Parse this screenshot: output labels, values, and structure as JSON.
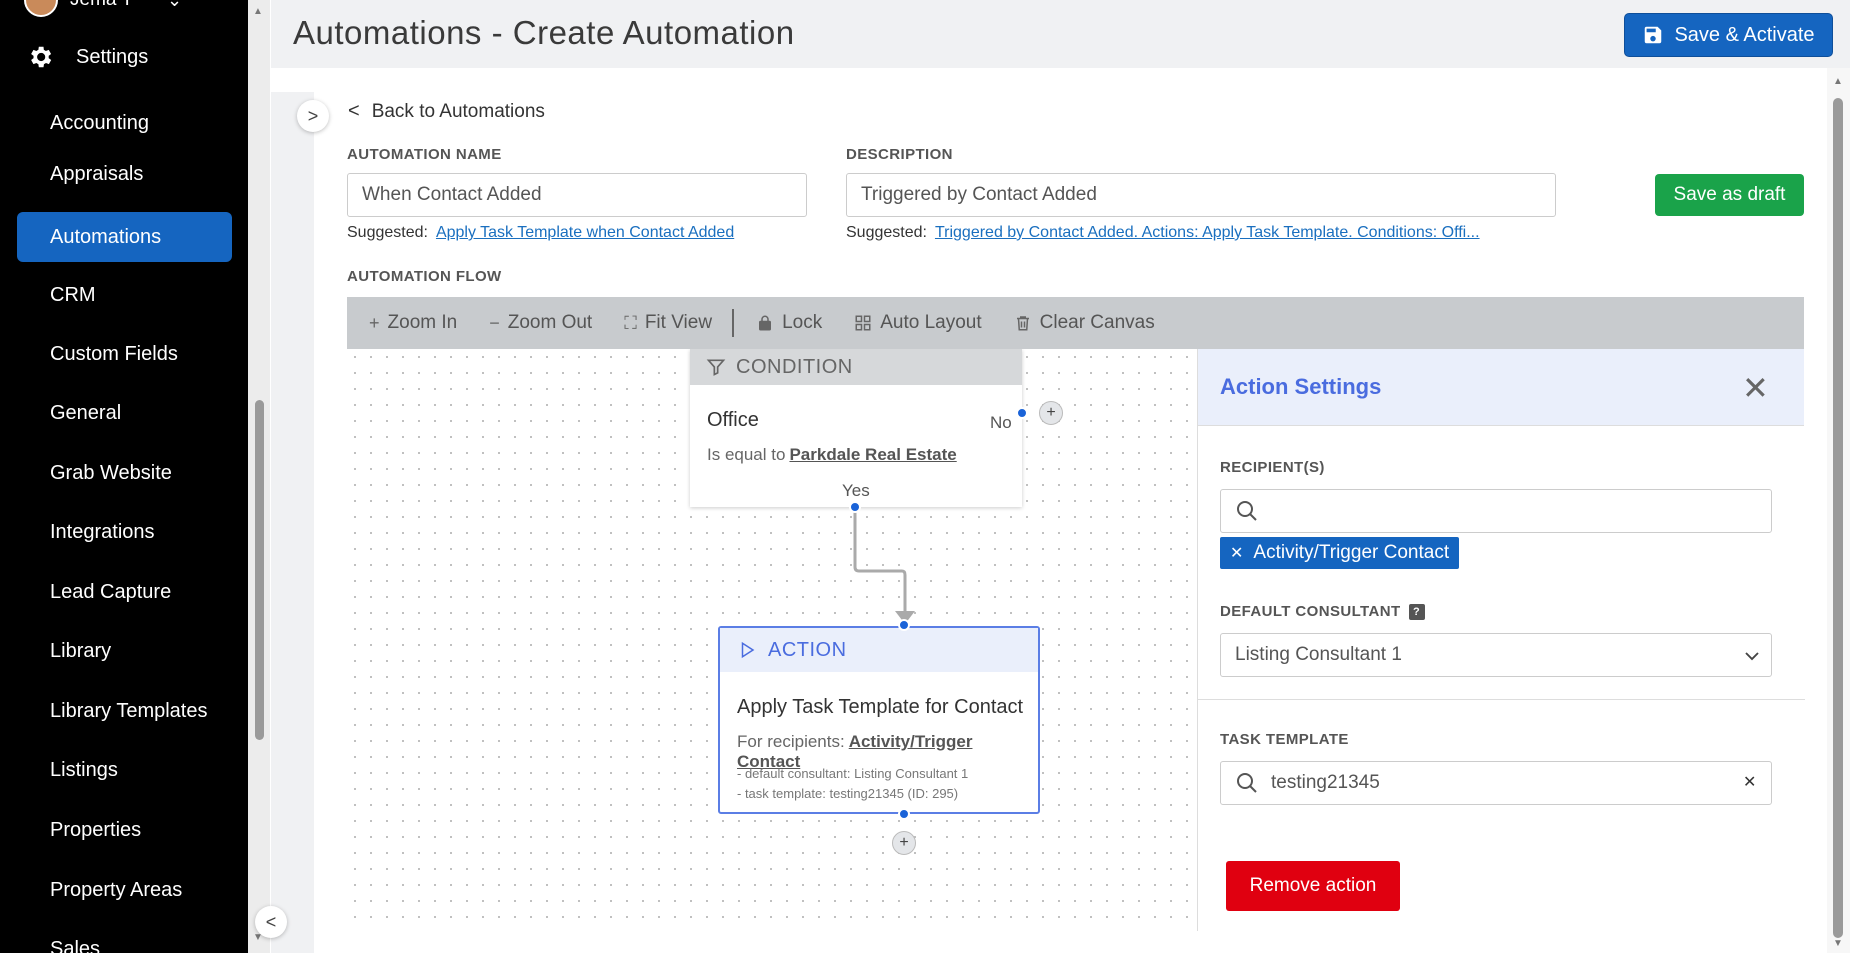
{
  "sidebar": {
    "user_name": "Jema T",
    "settings_label": "Settings",
    "items": [
      {
        "label": "Accounting"
      },
      {
        "label": "Appraisals"
      },
      {
        "label": "Automations"
      },
      {
        "label": "CRM"
      },
      {
        "label": "Custom Fields"
      },
      {
        "label": "General"
      },
      {
        "label": "Grab Website"
      },
      {
        "label": "Integrations"
      },
      {
        "label": "Lead Capture"
      },
      {
        "label": "Library"
      },
      {
        "label": "Library Templates"
      },
      {
        "label": "Listings"
      },
      {
        "label": "Properties"
      },
      {
        "label": "Property Areas"
      },
      {
        "label": "Sales"
      }
    ],
    "active_item": "Automations"
  },
  "header": {
    "title": "Automations - Create Automation",
    "save_activate_label": "Save & Activate"
  },
  "form": {
    "back_label": "Back to Automations",
    "name_label": "AUTOMATION NAME",
    "name_value": "When Contact Added",
    "name_suggested_prefix": "Suggested:",
    "name_suggested": "Apply Task Template when Contact Added",
    "desc_label": "DESCRIPTION",
    "desc_value": "Triggered by Contact Added",
    "desc_suggested_prefix": "Suggested:",
    "desc_suggested": "Triggered by Contact Added. Actions: Apply Task Template. Conditions: Offi...",
    "save_draft_label": "Save as draft",
    "flow_label": "AUTOMATION FLOW"
  },
  "toolbar": {
    "zoom_in": "Zoom In",
    "zoom_out": "Zoom Out",
    "fit_view": "Fit View",
    "lock": "Lock",
    "auto_layout": "Auto Layout",
    "clear_canvas": "Clear Canvas"
  },
  "flow": {
    "condition": {
      "header": "CONDITION",
      "title": "Office",
      "operator": "Is equal to",
      "value": "Parkdale Real Estate",
      "no_label": "No",
      "yes_label": "Yes"
    },
    "action": {
      "header": "ACTION",
      "title": "Apply Task Template for Contact",
      "recipients_prefix": "For recipients:",
      "recipients_value": "Activity/Trigger Contact",
      "line1": "- default consultant: Listing Consultant 1",
      "line2": "- task template: testing21345 (ID: 295)"
    }
  },
  "panel": {
    "title": "Action Settings",
    "recipients_label": "RECIPIENT(S)",
    "recipients_search_value": "",
    "recipient_tag": "Activity/Trigger Contact",
    "default_consultant_label": "DEFAULT CONSULTANT",
    "default_consultant_value": "Listing Consultant 1",
    "task_template_label": "TASK TEMPLATE",
    "task_template_value": "testing21345",
    "remove_label": "Remove action"
  },
  "colors": {
    "primary": "#1565c0",
    "success": "#1aa34a",
    "danger": "#e00010",
    "accent_blue": "#4a6cdf"
  }
}
